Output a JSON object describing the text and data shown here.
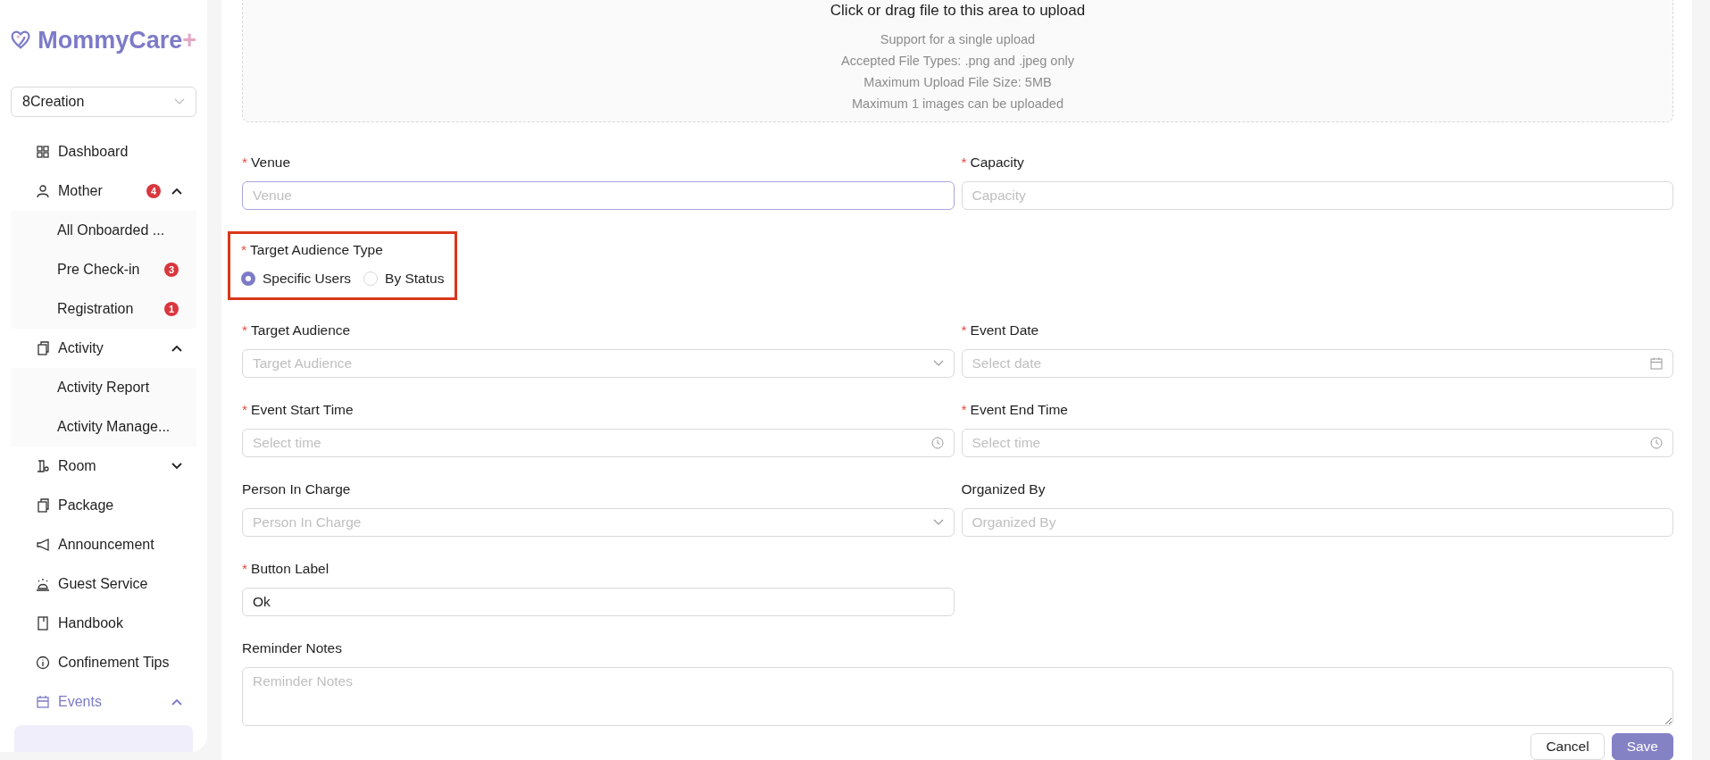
{
  "brand": {
    "name": "MommyCare",
    "mark": "+"
  },
  "org_select": {
    "value": "8Creation"
  },
  "nav": [
    {
      "label": "Dashboard",
      "selected": false
    },
    {
      "label": "Mother",
      "badge": "4",
      "expanded": true,
      "selected": false,
      "children": [
        {
          "label": "All Onboarded ...",
          "selected": false
        },
        {
          "label": "Pre Check-in",
          "badge": "3",
          "selected": false
        },
        {
          "label": "Registration",
          "badge": "1",
          "selected": false
        }
      ]
    },
    {
      "label": "Activity",
      "expanded": true,
      "selected": false,
      "children": [
        {
          "label": "Activity Report",
          "selected": false
        },
        {
          "label": "Activity Manage...",
          "selected": false
        }
      ]
    },
    {
      "label": "Room",
      "expanded": false,
      "selected": false
    },
    {
      "label": "Package",
      "selected": false
    },
    {
      "label": "Announcement",
      "selected": false
    },
    {
      "label": "Guest Service",
      "selected": false
    },
    {
      "label": "Handbook",
      "selected": false
    },
    {
      "label": "Confinement Tips",
      "selected": false
    },
    {
      "label": "Events",
      "expanded": true,
      "selected": true
    }
  ],
  "upload": {
    "title": "Click or drag file to this area to upload",
    "lines": [
      "Support for a single upload",
      "Accepted File Types: .png and .jpeg only",
      "Maximum Upload File Size: 5MB",
      "Maximum 1 images can be uploaded"
    ]
  },
  "rows": [
    [
      {
        "label": "Venue",
        "required_mark": "*",
        "kind": "input",
        "placeholder": "Venue",
        "focused": true
      },
      {
        "label": "Capacity",
        "required_mark": "*",
        "kind": "input",
        "placeholder": "Capacity"
      }
    ],
    [
      {
        "label": "Target Audience Type",
        "required_mark": "*",
        "kind": "radio",
        "highlighted": true,
        "options": [
          {
            "label": "Specific Users",
            "selected": true
          },
          {
            "label": "By Status",
            "selected": false
          }
        ]
      }
    ],
    [
      {
        "label": "Target Audience",
        "required_mark": "*",
        "kind": "select",
        "placeholder": "Target Audience"
      },
      {
        "label": "Event Date",
        "required_mark": "*",
        "kind": "date",
        "placeholder": "Select date"
      }
    ],
    [
      {
        "label": "Event Start Time",
        "required_mark": "*",
        "kind": "time",
        "placeholder": "Select time"
      },
      {
        "label": "Event End Time",
        "required_mark": "*",
        "kind": "time",
        "placeholder": "Select time"
      }
    ],
    [
      {
        "label": "Person In Charge",
        "kind": "select",
        "placeholder": "Person In Charge"
      },
      {
        "label": "Organized By",
        "kind": "input",
        "placeholder": "Organized By"
      }
    ],
    [
      {
        "label": "Button Label",
        "required_mark": "*",
        "kind": "input",
        "value": "Ok"
      }
    ],
    [
      {
        "label": "Reminder Notes",
        "kind": "textarea",
        "placeholder": "Reminder Notes"
      }
    ]
  ],
  "buttons": [
    {
      "label": "Cancel",
      "kind": "default"
    },
    {
      "label": "Save",
      "kind": "primary"
    }
  ]
}
